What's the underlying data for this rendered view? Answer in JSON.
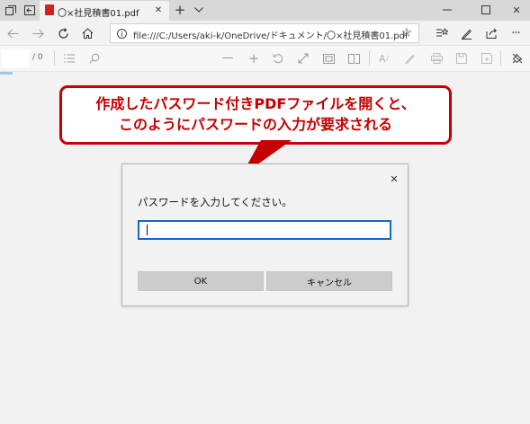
{
  "browser": {
    "tab_title": "〇×社見積書01.pdf",
    "url": "file:///C:/Users/aki-k/OneDrive/ドキュメント/〇×社見積書01.pdf"
  },
  "pdf_toolbar": {
    "page_count": "/ 0"
  },
  "callout": {
    "line1": "作成したパスワード付きPDFファイルを開くと、",
    "line2": "このようにパスワードの入力が要求される"
  },
  "dialog": {
    "prompt": "パスワードを入力してください。",
    "password_value": "",
    "ok_label": "OK",
    "cancel_label": "キャンセル",
    "close_glyph": "✕"
  },
  "colors": {
    "callout_red": "#c40000",
    "focus_blue": "#0d6ad1"
  }
}
